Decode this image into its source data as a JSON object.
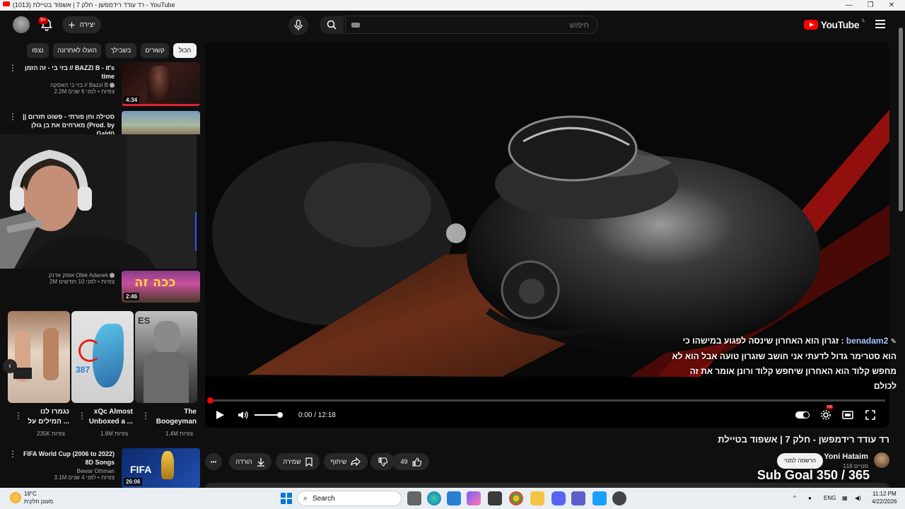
{
  "window": {
    "title": "רד עודד רידמפשן - חלק 7 | אשפוד בטיילת (1013) - YouTube",
    "minimize": "—",
    "maximize": "❐",
    "close": "✕"
  },
  "header": {
    "logo_text": "YouTube",
    "logo_superscript": "IL",
    "search_placeholder": "חיפוש",
    "create_label": "יצירה",
    "notif_count": "9+"
  },
  "chips": [
    "הכול",
    "קשורים",
    "בשבילך",
    "הועלו לאחרונה",
    "נצפו"
  ],
  "recommendations": [
    {
      "title": "בזי בי - זה הזמן // BAZZI B - it's time",
      "channel": "בזי בי האסקה // Bazzi B",
      "stats": "2.2M צפיות • לפני 6 שנים",
      "duration": "4:34"
    },
    {
      "title": "סטילה וחן פורתי - פשוט תזרום || מארחים את בן גולן (Prod. by Galdi)",
      "channel": "",
      "stats": "",
      "duration": ""
    },
    {
      "title": "",
      "channel": "אופק אדנק Ofek Adanek",
      "stats": "2M צפיות • לפני 10 חודשים",
      "duration": "2:46"
    },
    {
      "title": "FIFA World Cup (2006 to 2022) 8D Songs",
      "channel": "Bewar Othman",
      "stats": "3.1M צפיות • לפני 4 שנים",
      "duration": "26:06"
    }
  ],
  "shorts": [
    {
      "title": "The Boogeyman",
      "views": "1.4M צפיות"
    },
    {
      "title": "xQc Almost Unboxed a ...",
      "views": "1.8M צפיות",
      "badge": "387"
    },
    {
      "title": "נגמרו לנו המילים על ...",
      "views": "235K צפיות"
    }
  ],
  "player": {
    "time": "0:00 / 12:18",
    "progress_fraction": 0.0,
    "volume_fraction": 1.0,
    "settings_badge": "HD"
  },
  "chat_overlay": {
    "username": "benadam2",
    "message": ": זגרון הוא האחרון שינסה לפגוע במישהו כי הוא סטרימר גדול לדעתי אני חושב שזגרון טועה אבל הוא לא מחפש קלוד הוא האחרון שיחפש קלוד ורונן אומר את זה לכולם"
  },
  "video": {
    "title": "רד עודד רידמפשן - חלק 7 | אשפוד בטיילת",
    "channel_name": "Yoni Hataim",
    "subscribers": "118 מנויים",
    "subscribe_label": "הרשמה למנוי",
    "subgoal": "Sub Goal 350 / 365",
    "likes": "49",
    "share_label": "שיתוף",
    "save_label": "שמירה",
    "download_label": "הורדה",
    "more_label": "•••"
  },
  "taskbar": {
    "weather_temp": "19°C",
    "weather_desc": "מעונן חלקית",
    "search_label": "Search",
    "lang": "ENG",
    "time": "11:12 PM",
    "date": "4/22/2026"
  }
}
